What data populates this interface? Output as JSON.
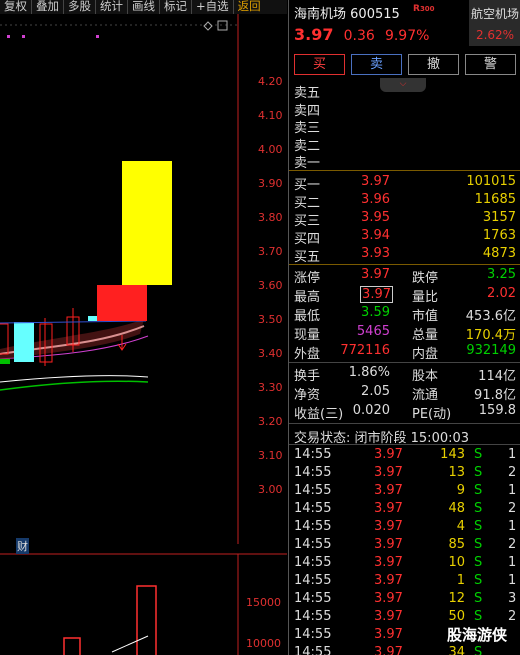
{
  "toolbar": {
    "items": [
      "复权",
      "叠加",
      "多股",
      "统计",
      "画线",
      "标记",
      "+自选",
      "返回"
    ]
  },
  "chart": {
    "price_ticks": [
      "4.20",
      "4.10",
      "4.00",
      "3.90",
      "3.80",
      "3.70",
      "3.60",
      "3.50",
      "3.40",
      "3.30",
      "3.20",
      "3.10",
      "3.00"
    ],
    "volume_ticks": [
      "15000",
      "10000"
    ],
    "marker_label": "财",
    "colors": {
      "up": "#ff2020",
      "limit_up_box": "#ffff00",
      "down": "#66ffff",
      "ma_white": "#ffffff",
      "ma_green": "#00c000",
      "ma_purple": "#d040d0"
    }
  },
  "stock": {
    "name": "海南机场",
    "code": "600515",
    "badge": "R",
    "badge_sub": "300",
    "price": "3.97",
    "change": "0.36",
    "change_pct": "9.97%",
    "sector_name": "航空机场",
    "sector_pct": "2.62%"
  },
  "buttons": {
    "buy": "买",
    "sell": "卖",
    "cancel": "撤",
    "alert": "警"
  },
  "asks": [
    {
      "label": "卖五",
      "price": "",
      "vol": ""
    },
    {
      "label": "卖四",
      "price": "",
      "vol": ""
    },
    {
      "label": "卖三",
      "price": "",
      "vol": ""
    },
    {
      "label": "卖二",
      "price": "",
      "vol": ""
    },
    {
      "label": "卖一",
      "price": "",
      "vol": ""
    }
  ],
  "bids": [
    {
      "label": "买一",
      "price": "3.97",
      "vol": "101015"
    },
    {
      "label": "买二",
      "price": "3.96",
      "vol": "11685"
    },
    {
      "label": "买三",
      "price": "3.95",
      "vol": "3157"
    },
    {
      "label": "买四",
      "price": "3.94",
      "vol": "1763"
    },
    {
      "label": "买五",
      "price": "3.93",
      "vol": "4873"
    }
  ],
  "stats": {
    "limit_up_label": "涨停",
    "limit_up": "3.97",
    "limit_down_label": "跌停",
    "limit_down": "3.25",
    "high_label": "最高",
    "high": "3.97",
    "vol_ratio_label": "量比",
    "vol_ratio": "2.02",
    "low_label": "最低",
    "low": "3.59",
    "mkt_cap_label": "市值",
    "mkt_cap": "453.6亿",
    "now_vol_label": "现量",
    "now_vol": "5465",
    "total_vol_label": "总量",
    "total_vol": "170.4万",
    "outer_label": "外盘",
    "outer": "772116",
    "inner_label": "内盘",
    "inner": "932149",
    "turnover_label": "换手",
    "turnover": "1.86%",
    "share_cap_label": "股本",
    "share_cap": "114亿",
    "nav_label": "净资",
    "nav": "2.05",
    "float_label": "流通",
    "float": "91.8亿",
    "eps_label": "收益(三)",
    "eps": "0.020",
    "pe_label": "PE(动)",
    "pe": "159.8"
  },
  "status_text": "交易状态: 闭市阶段 15:00:03",
  "ticks": [
    {
      "time": "14:55",
      "price": "3.97",
      "vol": "143",
      "side": "S",
      "n": "1"
    },
    {
      "time": "14:55",
      "price": "3.97",
      "vol": "13",
      "side": "S",
      "n": "2"
    },
    {
      "time": "14:55",
      "price": "3.97",
      "vol": "9",
      "side": "S",
      "n": "1"
    },
    {
      "time": "14:55",
      "price": "3.97",
      "vol": "48",
      "side": "S",
      "n": "2"
    },
    {
      "time": "14:55",
      "price": "3.97",
      "vol": "4",
      "side": "S",
      "n": "1"
    },
    {
      "time": "14:55",
      "price": "3.97",
      "vol": "85",
      "side": "S",
      "n": "2"
    },
    {
      "time": "14:55",
      "price": "3.97",
      "vol": "10",
      "side": "S",
      "n": "1"
    },
    {
      "time": "14:55",
      "price": "3.97",
      "vol": "1",
      "side": "S",
      "n": "1"
    },
    {
      "time": "14:55",
      "price": "3.97",
      "vol": "12",
      "side": "S",
      "n": "3"
    },
    {
      "time": "14:55",
      "price": "3.97",
      "vol": "50",
      "side": "S",
      "n": "2"
    },
    {
      "time": "14:55",
      "price": "3.97",
      "vol": "",
      "side": "",
      "n": ""
    },
    {
      "time": "14:55",
      "price": "3.97",
      "vol": "34",
      "side": "S",
      "n": ""
    }
  ],
  "watermark": "股海游侠"
}
